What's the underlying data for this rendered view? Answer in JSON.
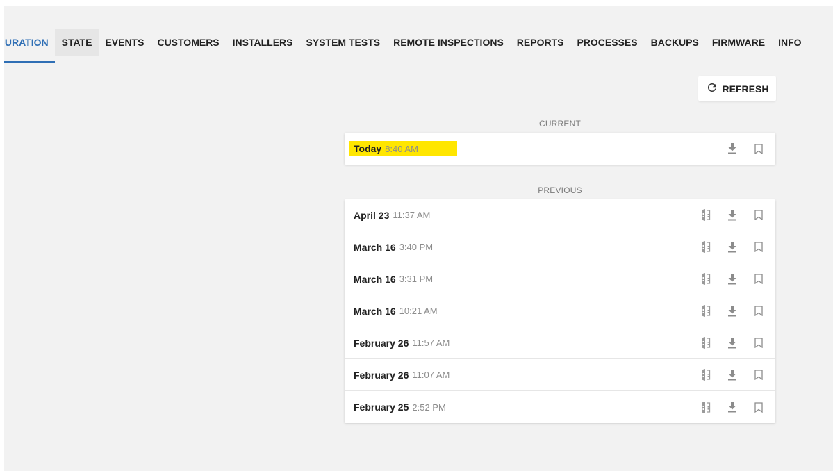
{
  "tabs": [
    {
      "label": "GURATION",
      "active": true
    },
    {
      "label": "STATE",
      "hover": true
    },
    {
      "label": "EVENTS"
    },
    {
      "label": "CUSTOMERS"
    },
    {
      "label": "INSTALLERS"
    },
    {
      "label": "SYSTEM TESTS"
    },
    {
      "label": "REMOTE INSPECTIONS"
    },
    {
      "label": "REPORTS"
    },
    {
      "label": "PROCESSES"
    },
    {
      "label": "BACKUPS"
    },
    {
      "label": "FIRMWARE"
    },
    {
      "label": "INFO"
    }
  ],
  "refresh": {
    "label": "REFRESH",
    "icon": "refresh-icon"
  },
  "current": {
    "label": "CURRENT",
    "item": {
      "date": "Today",
      "time": "8:40 AM",
      "highlighted": true
    }
  },
  "previous": {
    "label": "PREVIOUS",
    "items": [
      {
        "date": "April 23",
        "time": "11:37 AM"
      },
      {
        "date": "March 16",
        "time": "3:40 PM"
      },
      {
        "date": "March 16",
        "time": "3:31 PM"
      },
      {
        "date": "March 16",
        "time": "10:21 AM"
      },
      {
        "date": "February 26",
        "time": "11:57 AM"
      },
      {
        "date": "February 26",
        "time": "11:07 AM"
      },
      {
        "date": "February 25",
        "time": "2:52 PM"
      }
    ]
  },
  "icons": {
    "compare": "compare-icon",
    "download": "download-icon",
    "bookmark": "bookmark-icon"
  },
  "colors": {
    "accent": "#2f6fb5",
    "highlight": "#ffe600",
    "background": "#f2f2f2",
    "icon": "#8c8c8c"
  }
}
